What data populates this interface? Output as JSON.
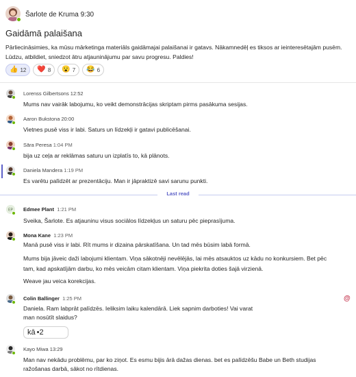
{
  "post": {
    "author": "Šarlote de Kruma",
    "time": "9:30",
    "title": "Gaidāmā palaišana",
    "body_line1": "Pārliecināsimies, ka mūsu mārketinga materiāls gaidāmajai palaišanai ir gatavs. Nākamnedēļ es tiksos ar ieinteresētajām pusēm.",
    "body_line2": "Lūdzu, atbildiet, sniedzot ātru atjauninājumu par savu progresu. Paldies!",
    "reactions": [
      {
        "emoji": "👍",
        "count": "12"
      },
      {
        "emoji": "❤️",
        "count": "8"
      },
      {
        "emoji": "😮",
        "count": "7"
      },
      {
        "emoji": "😂",
        "count": "6"
      }
    ]
  },
  "replies": [
    {
      "name": "Lorenss Gilbertsons",
      "time": "12:52",
      "text": "Mums nav vairāk labojumu, ko veikt demonstrācijas skriptam pirms pasākuma sesijas."
    },
    {
      "name": "Aaron Bukstona",
      "time": "20:00",
      "text": "Vietnes pusē viss ir labi. Saturs un līdzekļi ir gatavi publicēšanai."
    },
    {
      "name": "Sāra Peresa",
      "time": "1:04 PM",
      "text": "bija uz ceļa ar reklāmas saturu un izplatīs to, kā plānots."
    },
    {
      "name": "Daniela Mandera",
      "time": "1:19 PM",
      "text": "Es varētu palīdzēt ar prezentāciju. Man ir jāpraktizē savi sarunu punkti."
    }
  ],
  "last_read_label": "Last read",
  "new_replies": [
    {
      "initials": "EP",
      "name": "Edmee Plant",
      "time": "1:21 PM",
      "lines": [
        "Sveika, Šarlote. Es atjauninu visus sociālos līdzekļus un saturu pēc pieprasījuma."
      ]
    },
    {
      "name": "Mona Kane",
      "time": "1:23 PM",
      "lines": [
        "Manā pusē viss ir labi. Rīt mums ir dizaina pārskatīšana. Un tad mēs būsim labā formā.",
        "Mums bija jāveic daži labojumi klientam. Viņa sākotnēji nevēlējās, lai mēs atsauktos uz kādu no konkursiem. Bet pēc",
        "tam, kad apskatījām darbu, ko mēs veicām citam klientam. Viņa piekrita doties šajā virzienā.",
        "Weave jau veica korekcijas."
      ]
    },
    {
      "name": "Colin Ballinger",
      "time": "1:25 PM",
      "lines": [
        "Daniela. Ram labprāt palīdzēs. Ieliksim laiku kalendārā. Liek sapnim darboties! Vai varat",
        "man nosūtīt slaidus?"
      ],
      "inline_reaction": {
        "emoji": "kā",
        "count": "•2"
      },
      "mention": "@"
    },
    {
      "name": "Kayo Miwa",
      "time": "13:29",
      "lines": [
        "Man nav nekādu problēmu, par ko ziņot. Es esmu bijis ārā dažas dienas. bet es palīdzēšu Babe un Beth studijas",
        "ražošanas darbā, sākot no rītdienas."
      ]
    }
  ]
}
